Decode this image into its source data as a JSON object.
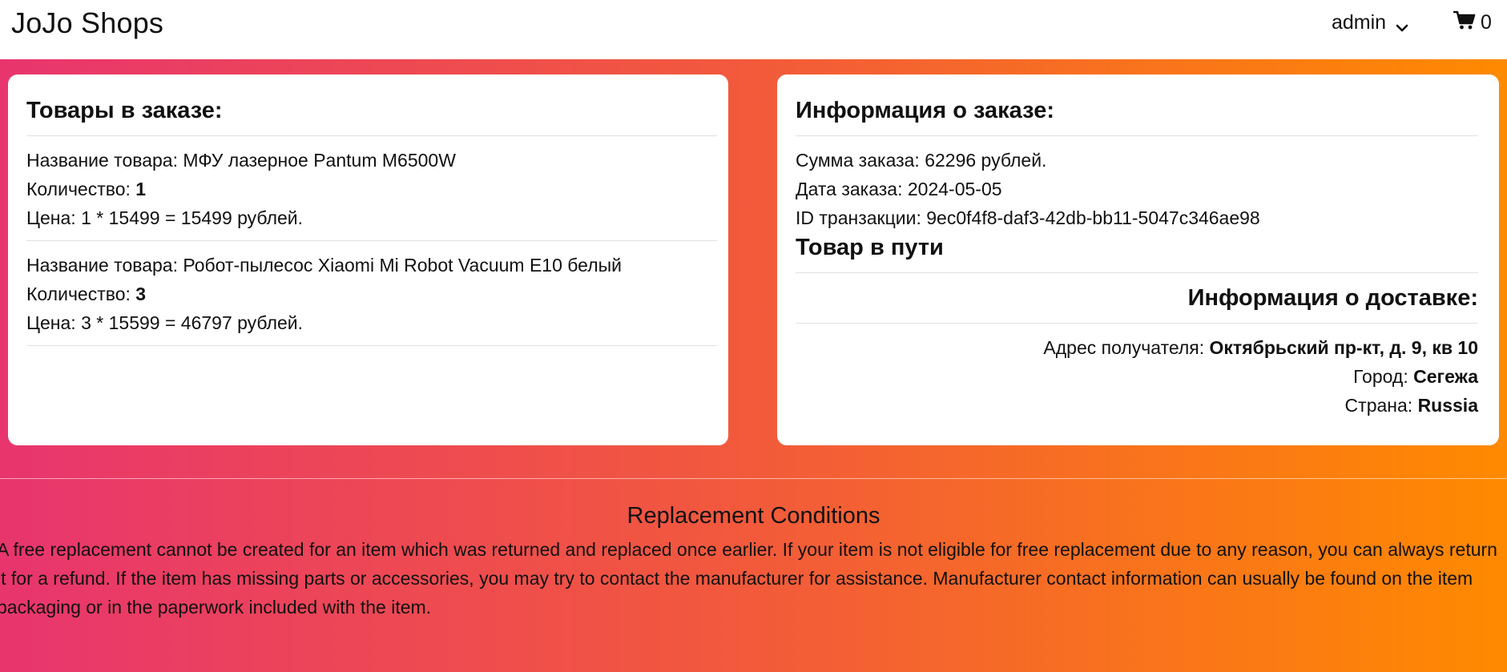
{
  "header": {
    "brand": "JoJo Shops",
    "user": "admin",
    "cart_count": "0"
  },
  "order_items": {
    "title": "Товары в заказе:",
    "name_label": "Название товара: ",
    "qty_label": "Количество: ",
    "price_label": "Цена: ",
    "items": [
      {
        "name": "МФУ лазерное Pantum M6500W",
        "qty": "1",
        "price": "1 * 15499 = 15499 рублей."
      },
      {
        "name": "Робот-пылесос Xiaomi Mi Robot Vacuum E10 белый",
        "qty": "3",
        "price": "3 * 15599 = 46797 рублей."
      }
    ]
  },
  "order_info": {
    "title": "Информация о заказе:",
    "sum": "Сумма заказа: 62296 рублей.",
    "date": "Дата заказа: 2024-05-05",
    "transaction": "ID транзакции: 9ec0f4f8-daf3-42db-bb11-5047c346ae98",
    "status": "Товар в пути"
  },
  "delivery": {
    "title": "Информация о доставке:",
    "address_label": "Адрес получателя: ",
    "address": "Октябрьский пр-кт, д. 9, кв 10",
    "city_label": "Город: ",
    "city": "Сегежа",
    "country_label": "Страна: ",
    "country": "Russia"
  },
  "footer": {
    "title": "Replacement Conditions",
    "text": "A free replacement cannot be created for an item which was returned and replaced once earlier. If your item is not eligible for free replacement due to any reason, you can always return it for a refund. If the item has missing parts or accessories, you may try to contact the manufacturer for assistance. Manufacturer contact information can usually be found on the item packaging or in the paperwork included with the item."
  },
  "colors": {
    "gradient_start": "#e8356e",
    "gradient_mid": "#f25a3b",
    "gradient_end": "#ff8a00"
  },
  "icons": {
    "user_menu": "chevron-down-icon",
    "cart": "shopping-cart-icon"
  }
}
